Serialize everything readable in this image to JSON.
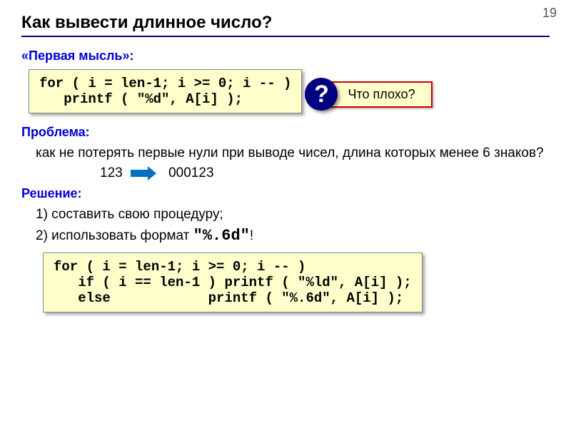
{
  "page_number": "19",
  "title": "Как вывести длинное число?",
  "s1": {
    "heading": "«Первая мысль»:",
    "code": "for ( i = len-1; i >= 0; i -- )\n   printf ( \"%d\", A[i] );",
    "q_mark": "?",
    "q_text": "Что плохо?"
  },
  "s2": {
    "heading": "Проблема:",
    "text": "как не потерять первые нули при выводе чисел, длина которых менее 6 знаков?",
    "example_left": "123",
    "example_right": "000123"
  },
  "s3": {
    "heading": "Решение:",
    "item1": "1) составить свою процедуру;",
    "item2_a": "2) использовать формат ",
    "item2_b": "\"%.6d\"",
    "item2_c": "!",
    "code": "for ( i = len-1; i >= 0; i -- )\n   if ( i == len-1 ) printf ( \"%ld\", A[i] );\n   else            printf ( \"%.6d\", A[i] );"
  }
}
